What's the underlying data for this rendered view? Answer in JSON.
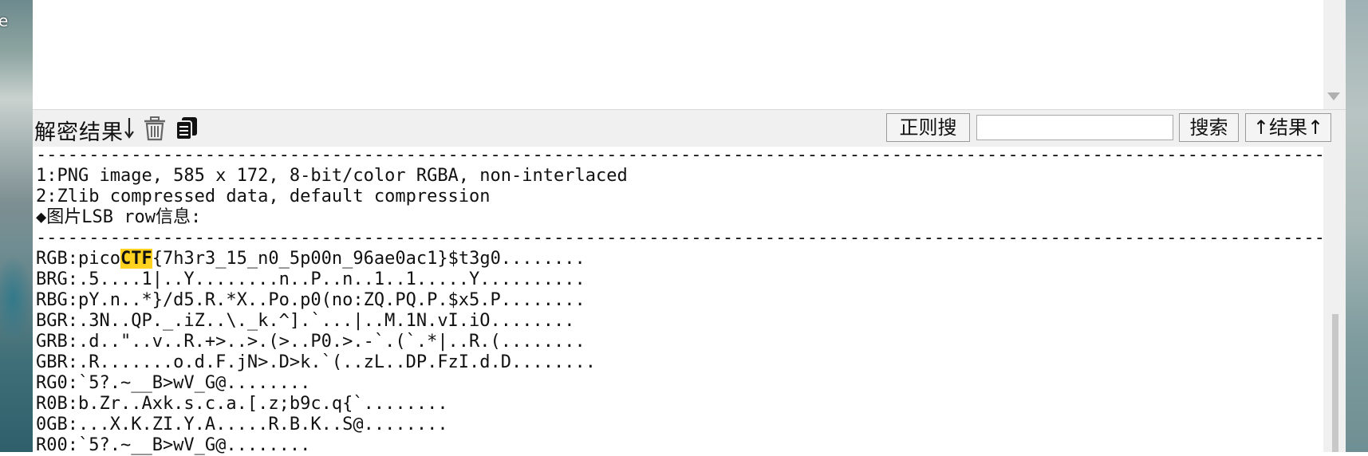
{
  "desktop": {
    "label": "e"
  },
  "toolbar": {
    "title": "解密结果",
    "regex_search_label": "正则搜",
    "search_input_value": "",
    "search_label": "搜索",
    "result_nav_label": "结果"
  },
  "output": {
    "separator": "---------------------------------------------------------------------------------------------------------------------------",
    "lines": [
      "1:PNG image, 585 x 172, 8-bit/color RGBA, non-interlaced",
      "2:Zlib compressed data, default compression",
      "◆图片LSB row信息:"
    ],
    "lsb_rows": [
      "BRG:.5....1|..Y........n..P..n..1..1.....Y..........",
      "RBG:pY.n..*}/d5.R.*X..Po.p0(no:ZQ.PQ.P.$x5.P........",
      "BGR:.3N..QP._.iZ..\\._k.^].`...|..M.1N.vI.iO........",
      "GRB:.d..\"..v..R.+>..>.(>..P0.>.-`.(`.*|..R.(........",
      "GBR:.R.......o.d.F.jN>.D>k.`(..zL..DP.FzI.d.D........",
      "RG0:`5?.~__B>wV_G@........",
      "R0B:b.Zr..Axk.s.c.a.[.z;b9c.q{`........",
      "0GB:...X.K.ZI.Y.A.....R.B.K..S@........",
      "R00:`5?.~__B>wV_G@........"
    ],
    "rgb_prefix": "RGB:pico",
    "rgb_highlight": "CTF",
    "rgb_suffix": "{7h3r3_15_n0_5p00n_96ae0ac1}$t3g0........"
  },
  "icons": [
    "download-arrow-icon",
    "trash-icon",
    "copy-icon",
    "up-arrow-icon",
    "dropdown-arrow-icon"
  ]
}
